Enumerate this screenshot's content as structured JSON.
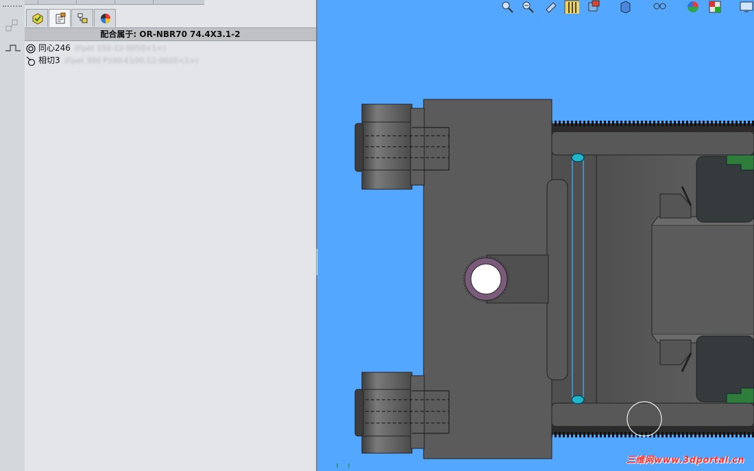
{
  "panel": {
    "header": "配合属于: OR-NBR70 74.4X3.1-2",
    "mates": [
      {
        "name": "同心246",
        "ref": "(Fpet 150-12-0050<1>)"
      },
      {
        "name": "相切3",
        "ref": "(Fpet 300 P100-E100-12-0020<1>)"
      }
    ]
  },
  "collapse": {
    "glyph": "‹‹‹"
  },
  "viewport": {
    "watermark": "三维网www.3dportal.cn",
    "colors": {
      "background": "#54a7ff",
      "body": "#5b5b5b",
      "seal": "#2f7d3a",
      "highlight": "#1fb6c9"
    }
  },
  "toolbar": {
    "icons": [
      "zoom-to-fit-icon",
      "zoom-area-icon",
      "previous-view-icon",
      "section-view-icon",
      "view-orientation-icon",
      "display-style-icon",
      "hide-show-icon",
      "appearance-icon",
      "scene-icon",
      "monitor-icon"
    ]
  }
}
